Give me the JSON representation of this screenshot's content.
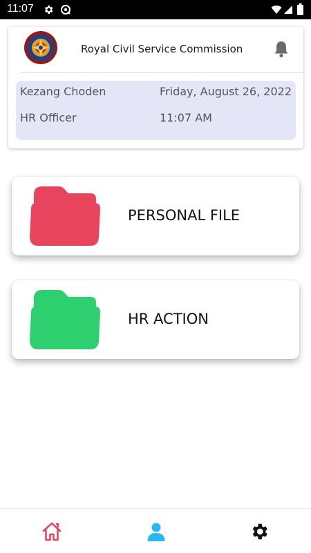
{
  "status_bar": {
    "time": "11:07",
    "icons": [
      "settings-icon",
      "vpn-icon",
      "wifi-icon",
      "signal-icon",
      "battery-icon"
    ]
  },
  "header": {
    "org_name": "Royal Civil Service Commission",
    "logo": "rcsc-emblem",
    "notification_icon": "bell-icon"
  },
  "user_info": {
    "name": "Kezang Choden",
    "role": "HR Officer",
    "date": "Friday, August 26, 2022",
    "time": "11:07 AM"
  },
  "menu": [
    {
      "label": "PERSONAL FILE",
      "icon": "folder-icon",
      "color": "#e9445d"
    },
    {
      "label": "HR ACTION",
      "icon": "folder-icon",
      "color": "#2ecf6e"
    }
  ],
  "bottom_nav": {
    "items": [
      {
        "icon": "home-icon",
        "color": "#e9445d"
      },
      {
        "icon": "person-icon",
        "color": "#29b6f6"
      },
      {
        "icon": "gear-icon",
        "color": "#111111"
      }
    ]
  }
}
